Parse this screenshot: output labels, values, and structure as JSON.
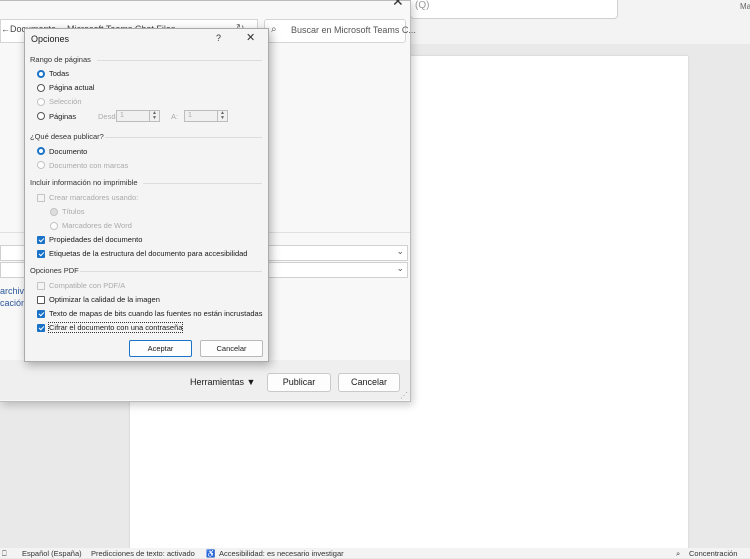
{
  "word": {
    "search_hint": "(Q)",
    "corner_label": "Ma"
  },
  "status_bar": {
    "language": "Español (España)",
    "text_predictions": "Predicciones de texto: activado",
    "accessibility": "Accesibilidad: es necesario investigar",
    "focus": "Concentración"
  },
  "save_dialog": {
    "path": [
      "Documento",
      "Microsoft Teams Chat Files"
    ],
    "search_placeholder": "Buscar en Microsoft Teams C...",
    "side_links": [
      "archiv",
      "cación"
    ],
    "tools_label": "Herramientas",
    "publish_label": "Publicar",
    "cancel_label": "Cancelar"
  },
  "options_dialog": {
    "title": "Opciones",
    "help": "?",
    "close": "✕",
    "range": {
      "header": "Rango de páginas",
      "all": "Todas",
      "current": "Página actual",
      "selection": "Selección",
      "pages": "Páginas",
      "from_label": "Desde:",
      "from_value": "1",
      "to_label": "A:",
      "to_value": "1",
      "selected": "all"
    },
    "publish": {
      "header": "¿Qué desea publicar?",
      "document": "Documento",
      "document_markup": "Documento con marcas",
      "selected": "document"
    },
    "nonprint": {
      "header": "Incluir información no imprimible",
      "create_bookmarks": "Crear marcadores usando:",
      "headings": "Títulos",
      "word_bookmarks": "Marcadores de Word",
      "doc_properties": "Propiedades del documento",
      "structure_tags": "Etiquetas de la estructura del documento para accesibilidad",
      "create_bookmarks_checked": false,
      "doc_properties_checked": true,
      "structure_tags_checked": true
    },
    "pdf": {
      "header": "Opciones PDF",
      "pdfa": "Compatible con PDF/A",
      "optimize": "Optimizar la calidad de la imagen",
      "bitmap": "Texto de mapas de bits cuando las fuentes no están incrustadas",
      "encrypt": "Cifrar el documento con una contraseña",
      "pdfa_checked": false,
      "optimize_checked": false,
      "bitmap_checked": true,
      "encrypt_checked": true
    },
    "ok": "Aceptar",
    "cancel": "Cancelar"
  }
}
